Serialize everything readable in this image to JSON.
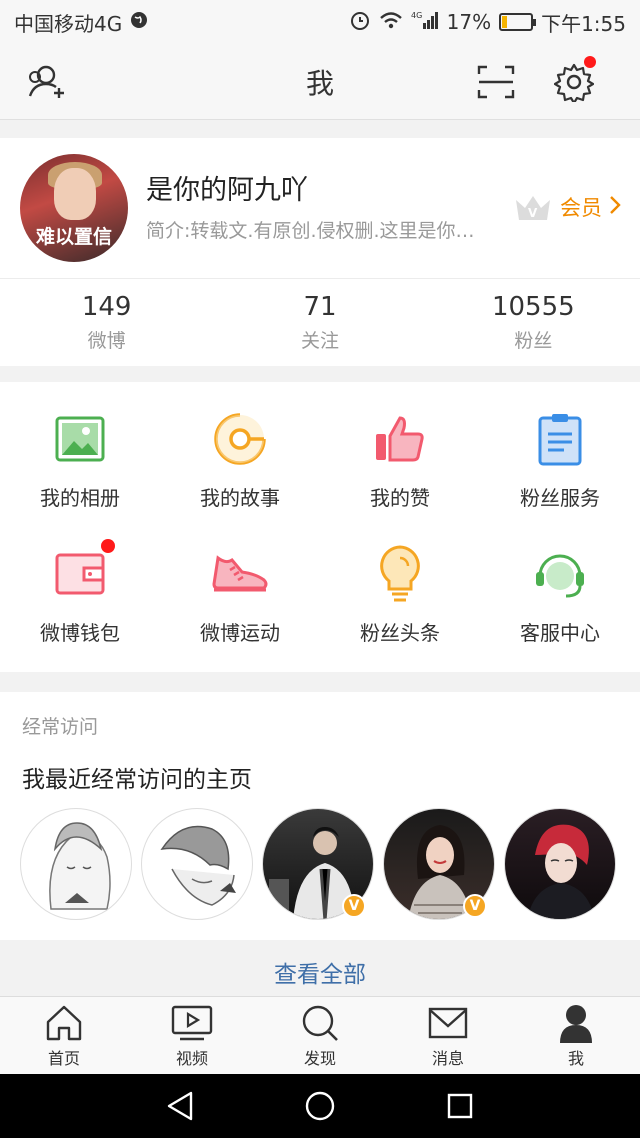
{
  "status_bar": {
    "carrier": "中国移动4G",
    "battery": "17%",
    "battery_fraction": 0.17,
    "time": "下午1:55"
  },
  "nav": {
    "title": "我",
    "icons": [
      "add-friend-icon",
      "scan-icon",
      "settings-icon"
    ]
  },
  "profile": {
    "avatar_caption": "难以置信",
    "name": "是你的阿九吖",
    "bio": "简介:转载文.有原创.侵权删.这里是你…",
    "member_label": "会员",
    "stats": [
      {
        "value": "149",
        "label": "微博"
      },
      {
        "value": "71",
        "label": "关注"
      },
      {
        "value": "10555",
        "label": "粉丝"
      }
    ]
  },
  "features": [
    {
      "label": "我的相册",
      "icon": "photo-album-icon",
      "color": "#4caf50"
    },
    {
      "label": "我的故事",
      "icon": "story-icon",
      "color": "#f5a623"
    },
    {
      "label": "我的赞",
      "icon": "thumbs-up-icon",
      "color": "#f25a6e"
    },
    {
      "label": "粉丝服务",
      "icon": "clipboard-icon",
      "color": "#3a8ee6"
    },
    {
      "label": "微博钱包",
      "icon": "wallet-icon",
      "color": "#f25a6e"
    },
    {
      "label": "微博运动",
      "icon": "sneaker-icon",
      "color": "#f25a6e"
    },
    {
      "label": "粉丝头条",
      "icon": "lightbulb-icon",
      "color": "#f5a623"
    },
    {
      "label": "客服中心",
      "icon": "headset-icon",
      "color": "#4caf50"
    }
  ],
  "visits": {
    "section_label": "经常访问",
    "title": "我最近经常访问的主页",
    "view_all": "查看全部"
  },
  "tabs": [
    {
      "label": "首页",
      "icon": "home-icon"
    },
    {
      "label": "视频",
      "icon": "video-icon"
    },
    {
      "label": "发现",
      "icon": "search-icon"
    },
    {
      "label": "消息",
      "icon": "mail-icon"
    },
    {
      "label": "我",
      "icon": "profile-icon"
    }
  ],
  "colors": {
    "accent_orange": "#f08a00",
    "link_blue": "#3f6fa8",
    "notification_red": "#ff1a1a"
  }
}
